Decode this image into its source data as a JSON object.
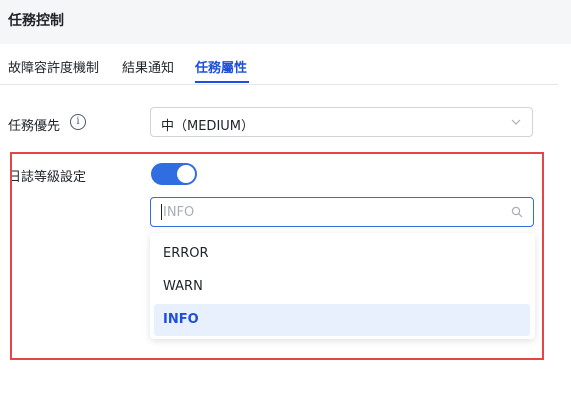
{
  "header": {
    "title": "任務控制"
  },
  "tabs": [
    {
      "label": "故障容許度機制",
      "active": false
    },
    {
      "label": "結果通知",
      "active": false
    },
    {
      "label": "任務屬性",
      "active": true
    }
  ],
  "priority": {
    "label": "任務優先",
    "info_icon": "info-circle-icon",
    "value": "中（MEDIUM）",
    "icon": "chevron-down-icon"
  },
  "log_level": {
    "label": "日誌等級設定",
    "toggle_on": true,
    "search_value": "INFO",
    "search_icon": "search-icon",
    "options": [
      {
        "label": "ERROR",
        "selected": false
      },
      {
        "label": "WARN",
        "selected": false
      },
      {
        "label": "INFO",
        "selected": true
      }
    ]
  },
  "colors": {
    "accent": "#2f6de1",
    "highlight_border": "#e54545",
    "selected_bg": "#e8f0fe"
  }
}
